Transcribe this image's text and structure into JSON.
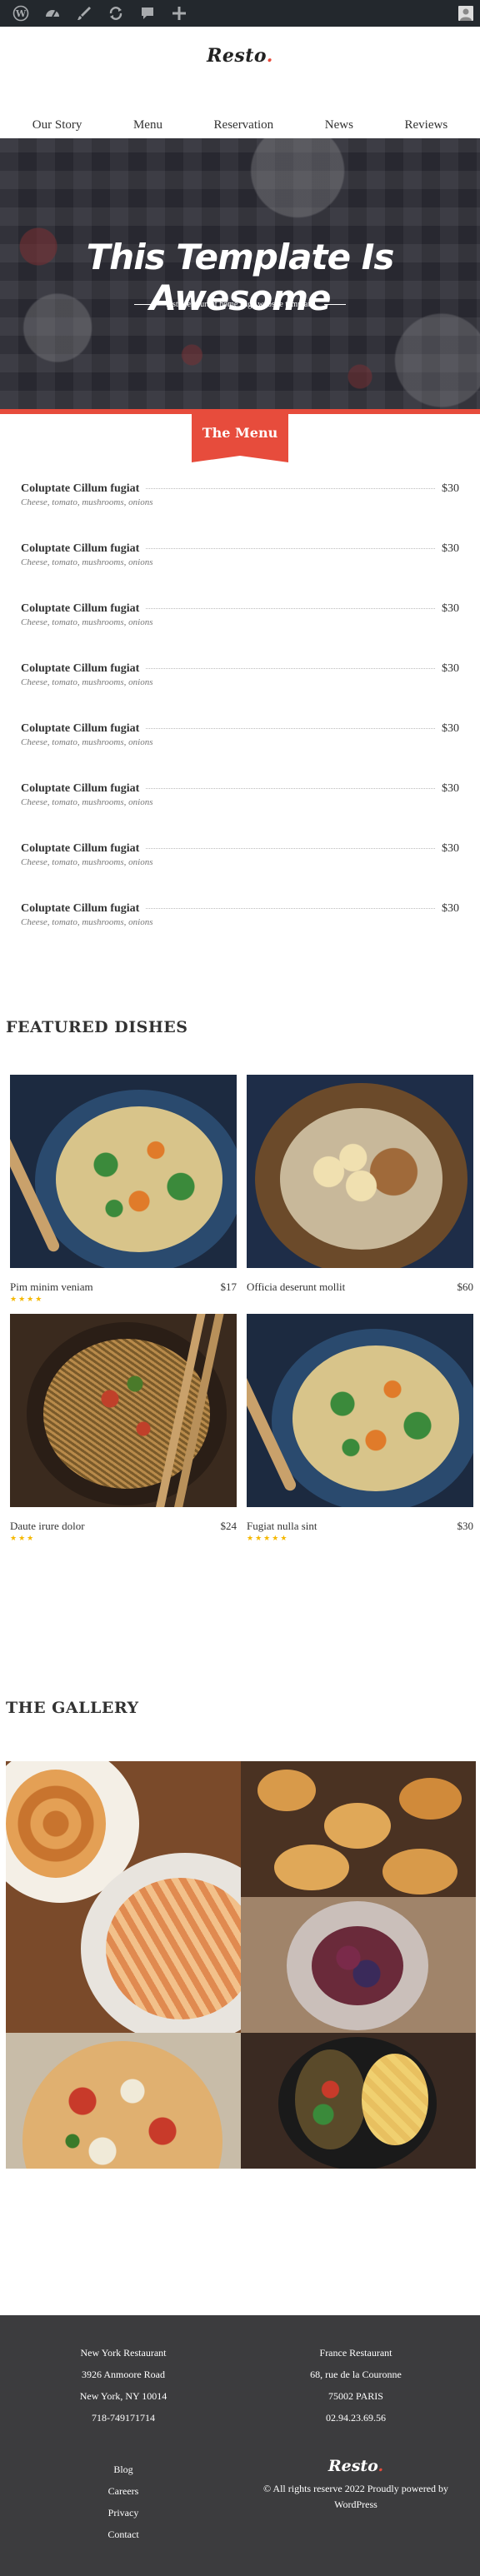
{
  "adminbar": {
    "icons": [
      "wordpress-icon",
      "dashboard-icon",
      "customize-icon",
      "updates-icon",
      "comments-icon",
      "new-content-icon"
    ]
  },
  "header": {
    "logo": "Resto",
    "nav": [
      "Our Story",
      "Menu",
      "Reservation",
      "News",
      "Reviews"
    ]
  },
  "hero": {
    "title": "This Template Is Awesome",
    "subtitle": "resto restaurant home page website template"
  },
  "menu": {
    "title": "The Menu",
    "items": [
      {
        "name": "Coluptate Cillum fugiat",
        "price": "$30",
        "desc": "Cheese, tomato, mushrooms, onions"
      },
      {
        "name": "Coluptate Cillum fugiat",
        "price": "$30",
        "desc": "Cheese, tomato, mushrooms, onions"
      },
      {
        "name": "Coluptate Cillum fugiat",
        "price": "$30",
        "desc": "Cheese, tomato, mushrooms, onions"
      },
      {
        "name": "Coluptate Cillum fugiat",
        "price": "$30",
        "desc": "Cheese, tomato, mushrooms, onions"
      },
      {
        "name": "Coluptate Cillum fugiat",
        "price": "$30",
        "desc": "Cheese, tomato, mushrooms, onions"
      },
      {
        "name": "Coluptate Cillum fugiat",
        "price": "$30",
        "desc": "Cheese, tomato, mushrooms, onions"
      },
      {
        "name": "Coluptate Cillum fugiat",
        "price": "$30",
        "desc": "Cheese, tomato, mushrooms, onions"
      },
      {
        "name": "Coluptate Cillum fugiat",
        "price": "$30",
        "desc": "Cheese, tomato, mushrooms, onions"
      }
    ]
  },
  "featured": {
    "title": "FEATURED DISHES",
    "dishes": [
      {
        "name": "Pim minim veniam",
        "price": "$17",
        "rating": 4
      },
      {
        "name": "Officia deserunt mollit",
        "price": "$60",
        "rating": 0
      },
      {
        "name": "Daute irure dolor",
        "price": "$24",
        "rating": 3
      },
      {
        "name": "Fugiat nulla sint",
        "price": "$30",
        "rating": 5
      }
    ]
  },
  "gallery": {
    "title": "THE GALLERY"
  },
  "footer": {
    "ny": [
      "New York Restaurant",
      "3926 Anmoore Road",
      "New York, NY 10014",
      "718-749171714"
    ],
    "fr": [
      "France Restaurant",
      "68, rue de la Couronne",
      "75002 PARIS",
      "02.94.23.69.56"
    ],
    "links": [
      "Blog",
      "Careers",
      "Privacy",
      "Contact"
    ],
    "logo": "Resto",
    "copyright": "© All rights reserve 2022 Proudly powered by",
    "powered": "WordPress"
  },
  "colors": {
    "accent": "#e74c3c",
    "adminbar": "#23282d",
    "footer": "#3c3c3e",
    "star": "#f5b800"
  }
}
